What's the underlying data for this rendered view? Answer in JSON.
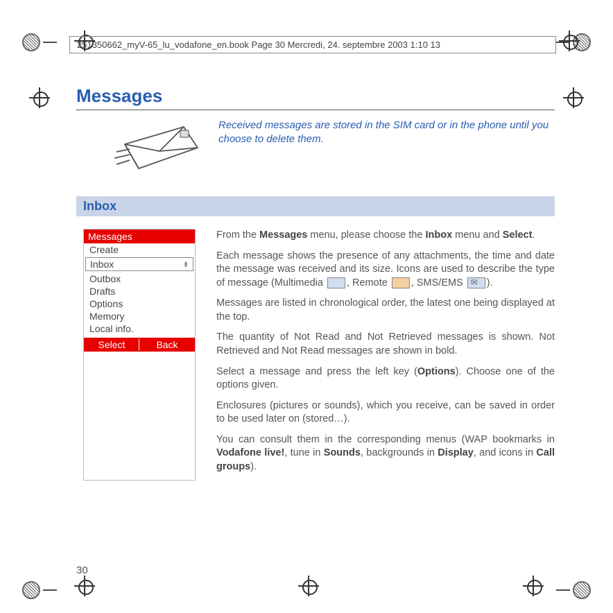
{
  "bookinfo": "251350662_myV-65_lu_vodafone_en.book  Page 30  Mercredi, 24. septembre 2003  1:10 13",
  "page_number": "30",
  "h1": "Messages",
  "intro": "Received messages are stored in the SIM card or in the phone until you choose to delete them.",
  "h2": "Inbox",
  "menu": {
    "title": "Messages",
    "create": "Create",
    "selected": "Inbox",
    "items": [
      "Outbox",
      "Drafts",
      "Options",
      "Memory",
      "Local info."
    ],
    "soft_left": "Select",
    "soft_right": "Back"
  },
  "para": {
    "p1a": "From the ",
    "p1b": "Messages",
    "p1c": " menu, please choose the ",
    "p1d": "Inbox",
    "p1e": " menu and ",
    "p1f": "Select",
    "p1g": ".",
    "p2": "Each message shows the presence of any attachments, the time and date the message was received and its size. Icons are used to describe the type of message (Multimedia ",
    "p2b": ", Remote ",
    "p2c": ", SMS/EMS ",
    "p2d": ").",
    "p3": "Messages are listed in chronological order, the latest one being displayed at the top.",
    "p4": "The quantity of Not Read and Not Retrieved messages is shown. Not Retrieved and Not Read messages are shown in bold.",
    "p5a": "Select a message and press the left key (",
    "p5b": "Options",
    "p5c": "). Choose one of the options given.",
    "p6": "Enclosures (pictures or sounds), which you receive, can be saved in order to be used later on (stored…).",
    "p7a": "You can consult them in the corresponding menus (WAP bookmarks in ",
    "p7b": "Vodafone live!",
    "p7c": ", tune in ",
    "p7d": "Sounds",
    "p7e": ", backgrounds in ",
    "p7f": "Display",
    "p7g": ", and icons in ",
    "p7h": "Call groups",
    "p7i": ")."
  }
}
